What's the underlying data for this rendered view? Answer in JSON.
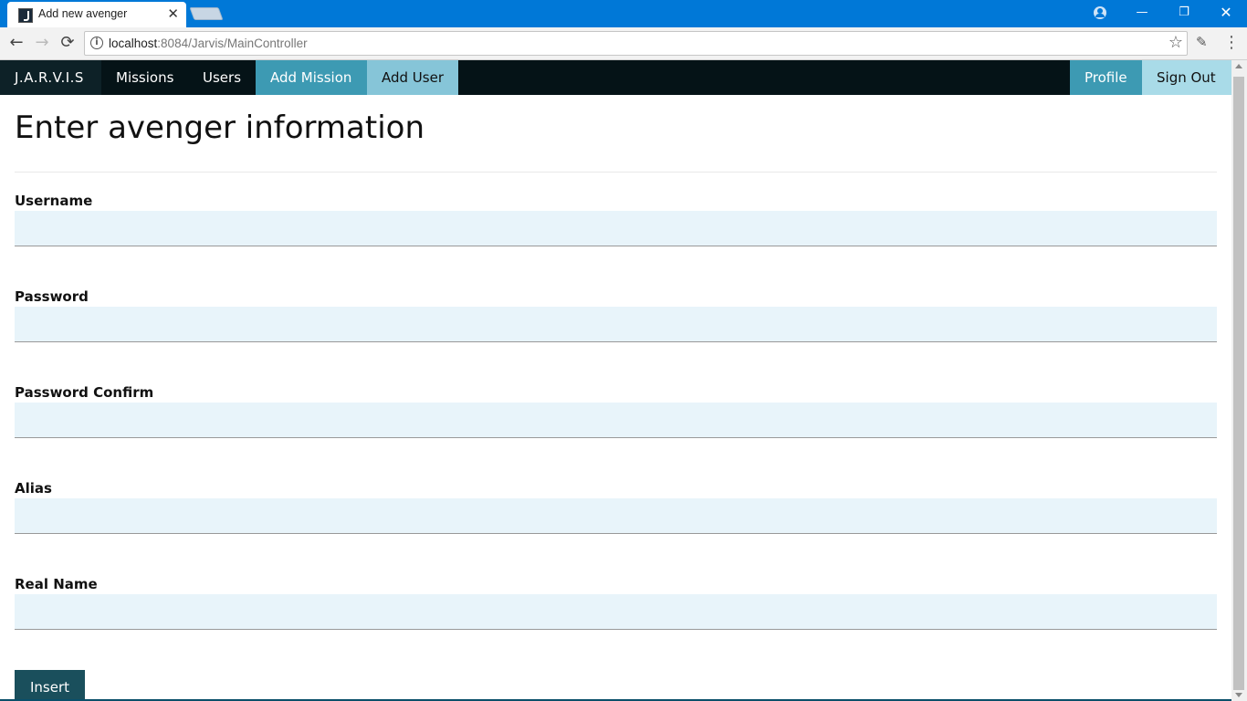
{
  "browser": {
    "tab_title": "Add new avenger",
    "tab_close": "✕",
    "url_host": "localhost",
    "url_path": ":8084/Jarvis/MainController",
    "back_icon": "←",
    "forward_icon": "→",
    "reload_icon": "⟳",
    "star_icon": "☆",
    "menu_icon": "⋮",
    "minimize_icon": "—",
    "restore_icon": "❐",
    "close_icon": "✕"
  },
  "navbar": {
    "brand": "J.A.R.V.I.S",
    "items": [
      {
        "label": "Missions"
      },
      {
        "label": "Users"
      },
      {
        "label": "Add Mission"
      },
      {
        "label": "Add User"
      }
    ],
    "right": [
      {
        "label": "Profile"
      },
      {
        "label": "Sign Out"
      }
    ]
  },
  "form": {
    "title": "Enter avenger information",
    "fields": [
      {
        "label": "Username",
        "value": ""
      },
      {
        "label": "Password",
        "value": ""
      },
      {
        "label": "Password Confirm",
        "value": ""
      },
      {
        "label": "Alias",
        "value": ""
      },
      {
        "label": "Real Name",
        "value": ""
      }
    ],
    "submit_label": "Insert"
  },
  "colors": {
    "titlebar": "#0078d7",
    "navbar_bg": "#051317",
    "nav_active": "#3d9ab3",
    "input_bg": "#e8f4fa",
    "button_bg": "#1a4f5c"
  }
}
